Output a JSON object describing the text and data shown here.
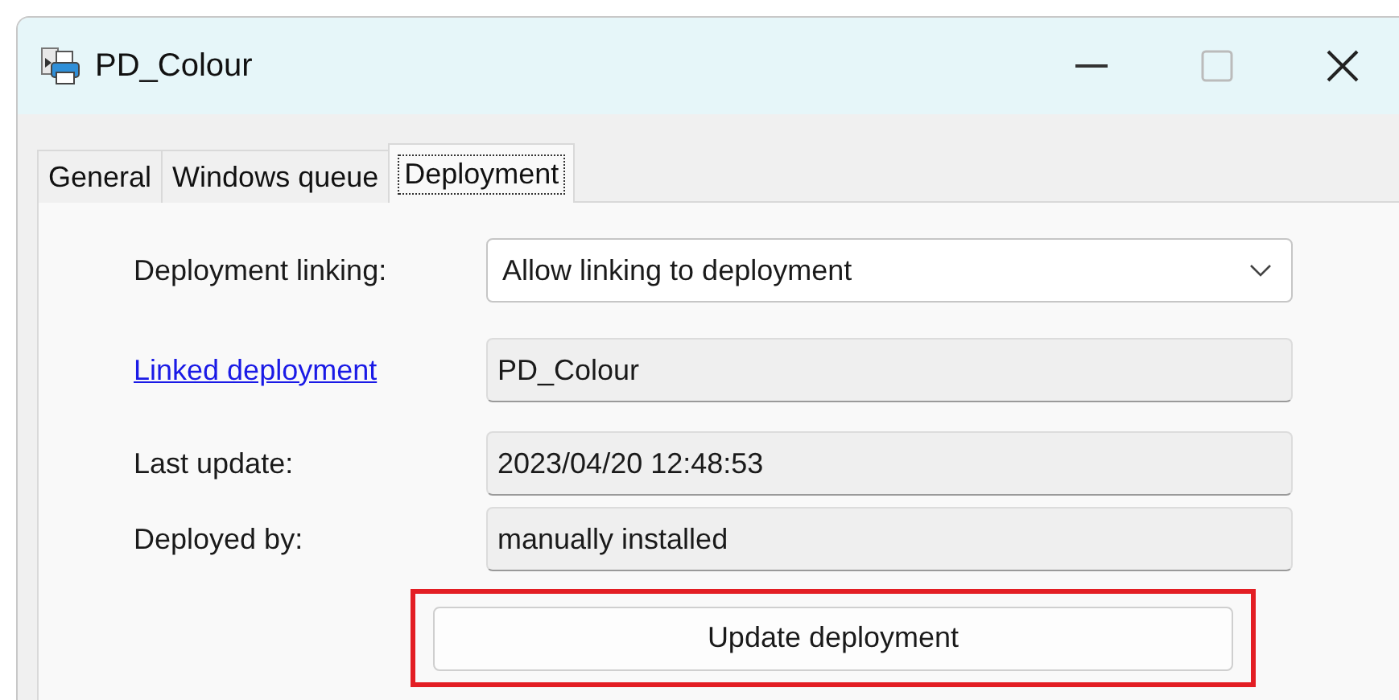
{
  "window": {
    "title": "PD_Colour"
  },
  "tabs": [
    {
      "label": "General",
      "selected": false
    },
    {
      "label": "Windows queue",
      "selected": false
    },
    {
      "label": "Deployment",
      "selected": true
    }
  ],
  "form": [
    {
      "kind": "dropdown",
      "label": "Deployment linking:",
      "value": "Allow linking to deployment"
    },
    {
      "kind": "link",
      "label": "Linked deployment",
      "value": "PD_Colour"
    },
    {
      "kind": "readonly",
      "label": "Last update:",
      "value": "2023/04/20 12:48:53"
    },
    {
      "kind": "readonly",
      "label": "Deployed by:",
      "value": "manually installed"
    }
  ],
  "action": {
    "label": "Update deployment",
    "highlighted": true
  }
}
